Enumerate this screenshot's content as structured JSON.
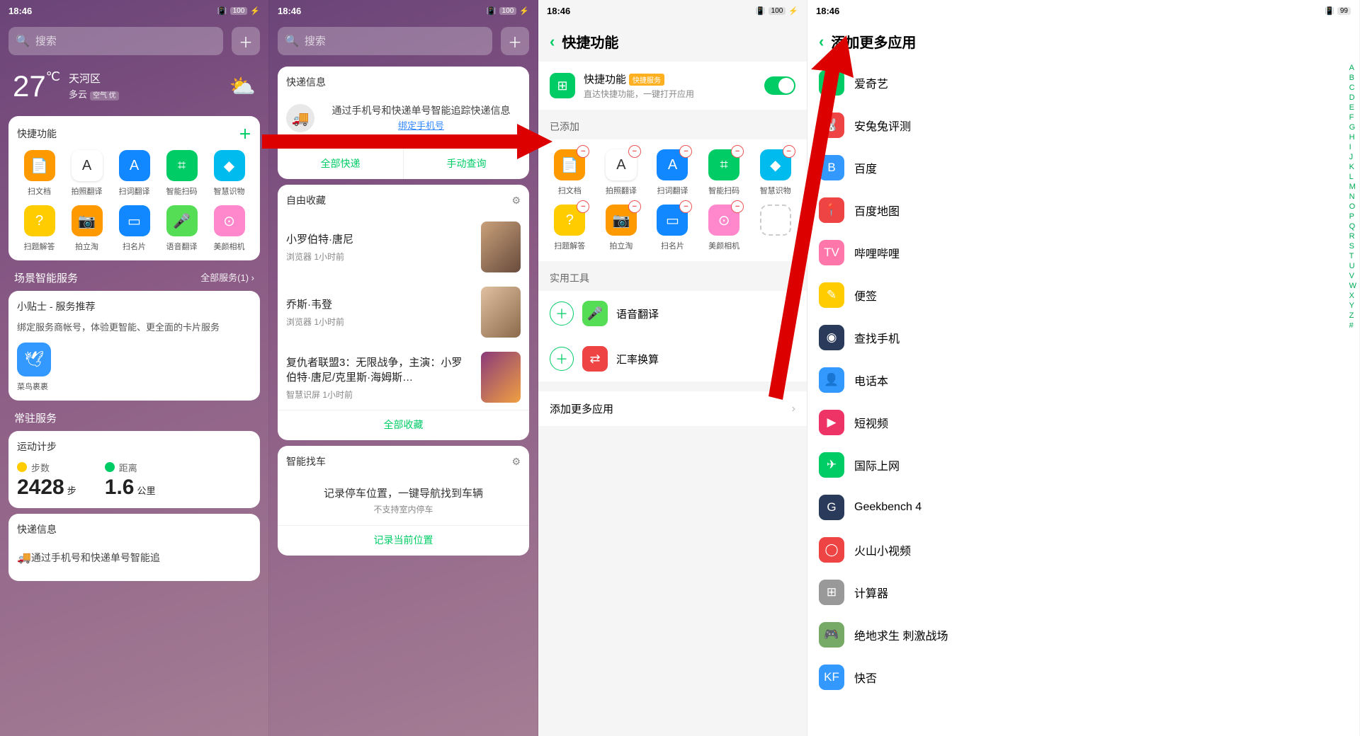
{
  "status": {
    "time": "18:46",
    "battery_left": "100",
    "battery_right": "99",
    "vibrate_icon": "📳",
    "charge_icon": "⚡"
  },
  "search_placeholder": "搜索",
  "screen1": {
    "weather": {
      "temp": "27",
      "unit": "℃",
      "area": "天河区",
      "cond": "多云",
      "quality": "空气 优"
    },
    "quick_title": "快捷功能",
    "quick_items": [
      {
        "label": "扫文档",
        "c": "ic-orange",
        "g": "📄"
      },
      {
        "label": "拍照翻译",
        "c": "ic-white",
        "g": "A"
      },
      {
        "label": "扫词翻译",
        "c": "ic-blue",
        "g": "A"
      },
      {
        "label": "智能扫码",
        "c": "ic-green",
        "g": "⌗"
      },
      {
        "label": "智慧识物",
        "c": "ic-cyan",
        "g": "◆"
      },
      {
        "label": "扫题解答",
        "c": "ic-yel",
        "g": "?"
      },
      {
        "label": "拍立淘",
        "c": "ic-orange",
        "g": "📷"
      },
      {
        "label": "扫名片",
        "c": "ic-blue",
        "g": "▭"
      },
      {
        "label": "语音翻译",
        "c": "ic-lgreen",
        "g": "🎤"
      },
      {
        "label": "美颜相机",
        "c": "ic-pink",
        "g": "⊙"
      }
    ],
    "scene_title": "场景智能服务",
    "scene_more": "全部服务(1) ›",
    "tips_title": "小贴士 - 服务推荐",
    "tips_text": "绑定服务商帐号，体验更智能、更全面的卡片服务",
    "tips_app": "菜鸟裹裹",
    "resident_title": "常驻服务",
    "steps_title": "运动计步",
    "steps_label": "步数",
    "steps_val": "2428",
    "steps_unit": "步",
    "dist_label": "距离",
    "dist_val": "1.6",
    "dist_unit": "公里",
    "express_title": "快递信息",
    "express_text": "通过手机号和快递单号智能追"
  },
  "screen2": {
    "express_title": "快递信息",
    "express_text": "通过手机号和快递单号智能追踪快递信息",
    "express_link": "绑定手机号",
    "express_all": "全部快递",
    "express_manual": "手动查询",
    "fav_title": "自由收藏",
    "favs": [
      {
        "title": "小罗伯特·唐尼",
        "meta": "浏览器 1小时前",
        "img": "face1"
      },
      {
        "title": "乔斯·韦登",
        "meta": "浏览器 1小时前",
        "img": "face2"
      },
      {
        "title": "复仇者联盟3：无限战争，主演：小罗伯特·唐尼/克里斯·海姆斯…",
        "meta": "智慧识屏 1小时前",
        "img": "poster"
      }
    ],
    "fav_all": "全部收藏",
    "car_title": "智能找车",
    "car_text": "记录停车位置，一键导航找到车辆",
    "car_sub": "不支持室内停车",
    "car_btn": "记录当前位置"
  },
  "screen3": {
    "title": "快捷功能",
    "toggle_title": "快捷功能",
    "toggle_tag": "快捷服务",
    "toggle_sub": "直达快捷功能，一键打开应用",
    "added_title": "已添加",
    "added_items": [
      {
        "label": "扫文档",
        "c": "ic-orange",
        "g": "📄"
      },
      {
        "label": "拍照翻译",
        "c": "ic-white",
        "g": "A"
      },
      {
        "label": "扫词翻译",
        "c": "ic-blue",
        "g": "A"
      },
      {
        "label": "智能扫码",
        "c": "ic-green",
        "g": "⌗"
      },
      {
        "label": "智慧识物",
        "c": "ic-cyan",
        "g": "◆"
      },
      {
        "label": "扫题解答",
        "c": "ic-yel",
        "g": "?"
      },
      {
        "label": "拍立淘",
        "c": "ic-orange",
        "g": "📷"
      },
      {
        "label": "扫名片",
        "c": "ic-blue",
        "g": "▭"
      },
      {
        "label": "美颜相机",
        "c": "ic-pink",
        "g": "⊙"
      }
    ],
    "tools_title": "实用工具",
    "tools": [
      {
        "label": "语音翻译",
        "c": "ic-lgreen",
        "g": "🎤"
      },
      {
        "label": "汇率换算",
        "c": "ic-red",
        "g": "⇄"
      }
    ],
    "add_more": "添加更多应用"
  },
  "screen4": {
    "title": "添加更多应用",
    "apps": [
      {
        "name": "爱奇艺",
        "c": "ic-green",
        "g": "▶"
      },
      {
        "name": "安兔兔评测",
        "c": "ic-red",
        "g": "🐰"
      },
      {
        "name": "百度",
        "c": "ic-sky",
        "g": "B"
      },
      {
        "name": "百度地图",
        "c": "ic-red",
        "g": "📍"
      },
      {
        "name": "哔哩哔哩",
        "c": "ic-bili",
        "g": "TV"
      },
      {
        "name": "便签",
        "c": "ic-yel",
        "g": "✎"
      },
      {
        "name": "查找手机",
        "c": "ic-dark",
        "g": "◉"
      },
      {
        "name": "电话本",
        "c": "ic-sky",
        "g": "👤"
      },
      {
        "name": "短视频",
        "c": "ic-rose",
        "g": "▶"
      },
      {
        "name": "国际上网",
        "c": "ic-green",
        "g": "✈"
      },
      {
        "name": "Geekbench 4",
        "c": "ic-dark",
        "g": "G"
      },
      {
        "name": "火山小视频",
        "c": "ic-red",
        "g": "◯"
      },
      {
        "name": "计算器",
        "c": "ic-gray",
        "g": "⊞"
      },
      {
        "name": "绝地求生 刺激战场",
        "c": "ic-olive",
        "g": "🎮"
      },
      {
        "name": "快否",
        "c": "ic-sky",
        "g": "KF"
      }
    ],
    "index": [
      "A",
      "B",
      "C",
      "D",
      "E",
      "F",
      "G",
      "H",
      "I",
      "J",
      "K",
      "L",
      "M",
      "N",
      "O",
      "P",
      "Q",
      "R",
      "S",
      "T",
      "U",
      "V",
      "W",
      "X",
      "Y",
      "Z",
      "#"
    ]
  }
}
